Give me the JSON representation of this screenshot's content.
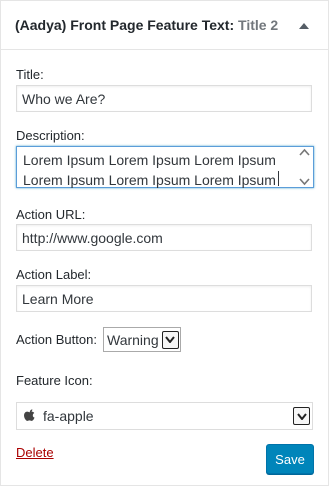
{
  "widget": {
    "title": "(Aadya) Front Page Feature Text",
    "separator": ":",
    "instance_title": " Title 2"
  },
  "form": {
    "title_label": "Title:",
    "title_value": "Who we Are?",
    "description_label": "Description:",
    "description_value": "Lorem Ipsum Lorem Ipsum Lorem Ipsum\nLorem Ipsum Lorem Ipsum Lorem Ipsum",
    "action_url_label": "Action URL:",
    "action_url_value": "http://www.google.com",
    "action_label_label": "Action Label:",
    "action_label_value": "Learn More",
    "action_button_label": "Action Button:",
    "action_button_value": "Warning",
    "feature_icon_label": "Feature Icon:",
    "feature_icon_value": "fa-apple",
    "feature_icon_glyph": "apple-icon"
  },
  "actions": {
    "delete_label": "Delete",
    "save_label": "Save"
  },
  "colors": {
    "primary_button": "#0085ba",
    "delete_link": "#aa0000",
    "focus_border": "#5b9dd9"
  }
}
